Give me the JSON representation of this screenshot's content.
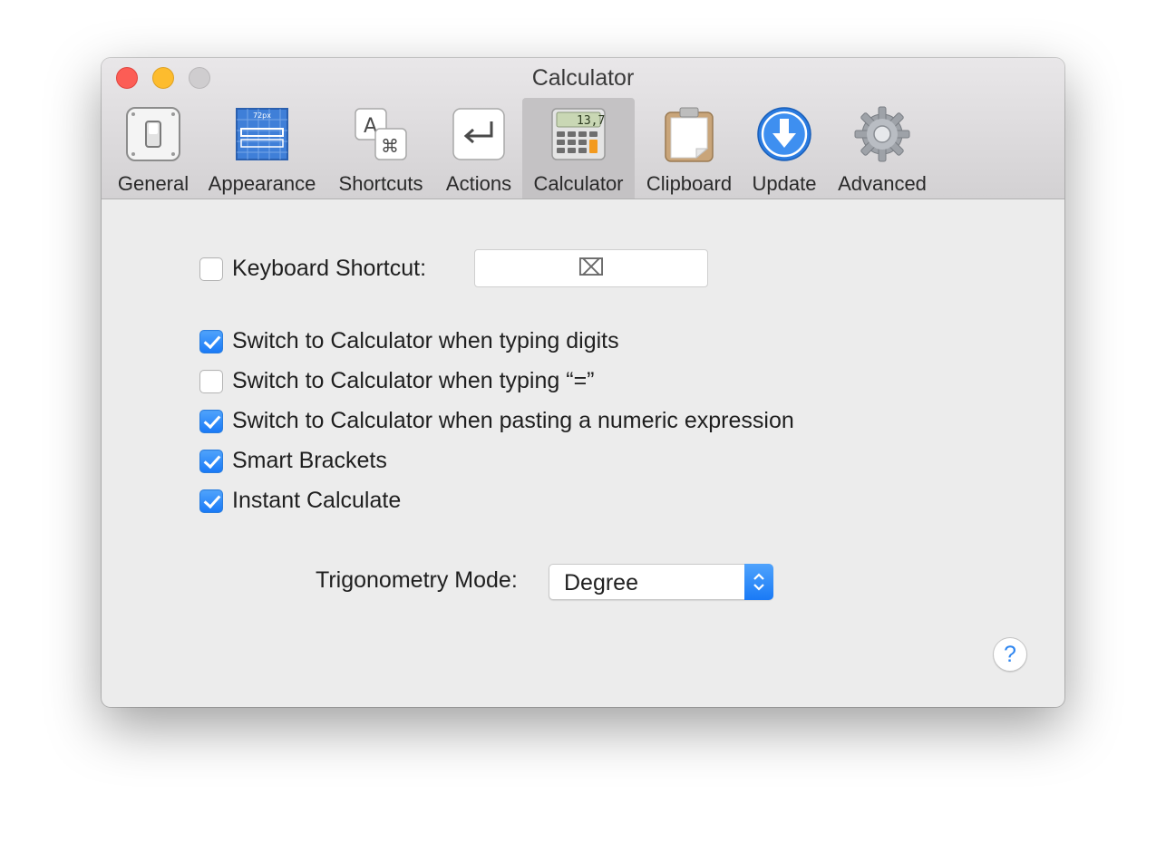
{
  "window": {
    "title": "Calculator"
  },
  "toolbar": {
    "tabs": [
      {
        "label": "General",
        "icon": "light-switch-icon",
        "selected": false
      },
      {
        "label": "Appearance",
        "icon": "blueprint-icon",
        "selected": false
      },
      {
        "label": "Shortcuts",
        "icon": "keyboard-keys-icon",
        "selected": false
      },
      {
        "label": "Actions",
        "icon": "return-key-icon",
        "selected": false
      },
      {
        "label": "Calculator",
        "icon": "calculator-icon",
        "selected": true
      },
      {
        "label": "Clipboard",
        "icon": "clipboard-icon",
        "selected": false
      },
      {
        "label": "Update",
        "icon": "download-arrow-icon",
        "selected": false
      },
      {
        "label": "Advanced",
        "icon": "gear-icon",
        "selected": false
      }
    ],
    "appearance_icon_text": "72px",
    "calculator_icon_display": "13,7"
  },
  "settings": {
    "keyboard_shortcut": {
      "label": "Keyboard Shortcut:",
      "checked": false,
      "value_glyph": "⌧"
    },
    "options": [
      {
        "label": "Switch to Calculator when typing digits",
        "checked": true
      },
      {
        "label": "Switch to Calculator when typing “=”",
        "checked": false
      },
      {
        "label": "Switch to Calculator when pasting a numeric expression",
        "checked": true
      },
      {
        "label": "Smart Brackets",
        "checked": true
      },
      {
        "label": "Instant Calculate",
        "checked": true
      }
    ],
    "trigonometry": {
      "label": "Trigonometry Mode:",
      "value": "Degree"
    }
  },
  "help": {
    "label": "?"
  },
  "colors": {
    "accent": "#1a7af6",
    "window_bg": "#ececec",
    "close": "#fc5d55",
    "minimize": "#fdbc2e",
    "zoom": "#cfcdcf"
  }
}
